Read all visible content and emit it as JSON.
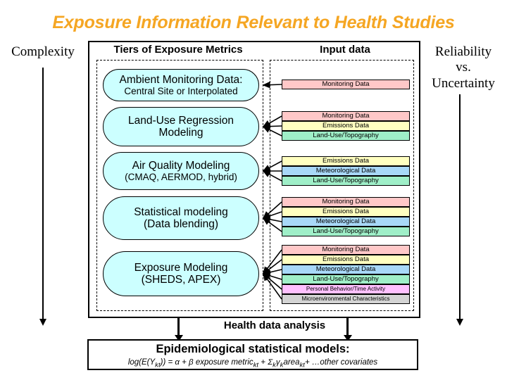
{
  "title": "Exposure Information Relevant to Health Studies",
  "side_labels": {
    "left": "Complexity",
    "right_line1": "Reliability",
    "right_line2": "vs.",
    "right_line3": "Uncertainty"
  },
  "columns": {
    "tiers_header": "Tiers of Exposure Metrics",
    "input_header": "Input data"
  },
  "tiers": [
    {
      "line1": "Ambient Monitoring Data:",
      "line2": "Central Site or Interpolated"
    },
    {
      "line1": "Land-Use Regression",
      "line2": "Modeling"
    },
    {
      "line1": "Air Quality Modeling",
      "line2": "(CMAQ, AERMOD, hybrid)"
    },
    {
      "line1": "Statistical modeling",
      "line2": "(Data blending)"
    },
    {
      "line1": "Exposure Modeling",
      "line2": "(SHEDS, APEX)"
    }
  ],
  "data_stacks": [
    {
      "rows": [
        {
          "label": "Monitoring Data",
          "color": "#FFC8C8"
        }
      ]
    },
    {
      "rows": [
        {
          "label": "Monitoring Data",
          "color": "#FFC8C8"
        },
        {
          "label": "Emissions Data",
          "color": "#FFFFC0"
        },
        {
          "label": "Land-Use/Topography",
          "color": "#9FEFC8"
        }
      ]
    },
    {
      "rows": [
        {
          "label": "Emissions Data",
          "color": "#FFFFC0"
        },
        {
          "label": "Meteorological Data",
          "color": "#A8D8F8"
        },
        {
          "label": "Land-Use/Topography",
          "color": "#9FEFC8"
        }
      ]
    },
    {
      "rows": [
        {
          "label": "Monitoring Data",
          "color": "#FFC8C8"
        },
        {
          "label": "Emissions Data",
          "color": "#FFFFC0"
        },
        {
          "label": "Meteorological Data",
          "color": "#A8D8F8"
        },
        {
          "label": "Land-Use/Topography",
          "color": "#9FEFC8"
        }
      ]
    },
    {
      "rows": [
        {
          "label": "Monitoring Data",
          "color": "#FFC8C8"
        },
        {
          "label": "Emissions Data",
          "color": "#FFFFC0"
        },
        {
          "label": "Meteorological Data",
          "color": "#A8D8F8"
        },
        {
          "label": "Land-Use/Topography",
          "color": "#9FEFC8"
        },
        {
          "label": "Personal Behavior/Time Activity",
          "color": "#FFC0FF"
        },
        {
          "label": "Microenvironmental Characteristics",
          "color": "#D4D4D4"
        }
      ]
    }
  ],
  "bottom": {
    "health_label": "Health data analysis",
    "epi_title": "Epidemiological statistical models:",
    "epi_formula": "log(E(Ykt)) = α + β exposure metrickt + Σkγkareakt+ …other covariates"
  },
  "colors": {
    "title": "#F5A623",
    "tier_fill": "#CCFFFF",
    "outline": "#000000"
  }
}
